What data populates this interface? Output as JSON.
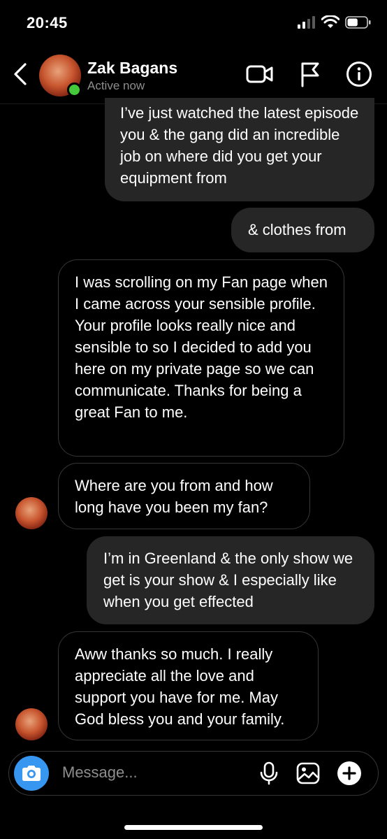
{
  "status_bar": {
    "time": "20:45",
    "battery_level": 0.55
  },
  "header": {
    "contact_name": "Zak Bagans",
    "status": "Active now"
  },
  "messages": [
    {
      "direction": "sent",
      "text": "I’ve just watched the latest episode you & the gang did an incredible job on where did you get your equipment from"
    },
    {
      "direction": "sent",
      "text": "& clothes from"
    },
    {
      "direction": "received",
      "text": "I was scrolling on my Fan page when I came across your sensible profile. Your profile looks really nice and sensible to so I decided to add you here on my private page so we can communicate. Thanks for being a great Fan to me."
    },
    {
      "direction": "received",
      "text": "Where are you from and how long have you been my fan?"
    },
    {
      "direction": "sent",
      "text": "I’m in Greenland & the only show we get is your show & I especially like when you get effected"
    },
    {
      "direction": "received",
      "text": "Aww thanks so much. I really appreciate all the love and support you have for me. May God bless you and your family."
    }
  ],
  "composer": {
    "placeholder": "Message..."
  },
  "colors": {
    "accent": "#3797f0",
    "online": "#44c93b",
    "sent_bubble": "#262626",
    "received_border": "#363636"
  }
}
